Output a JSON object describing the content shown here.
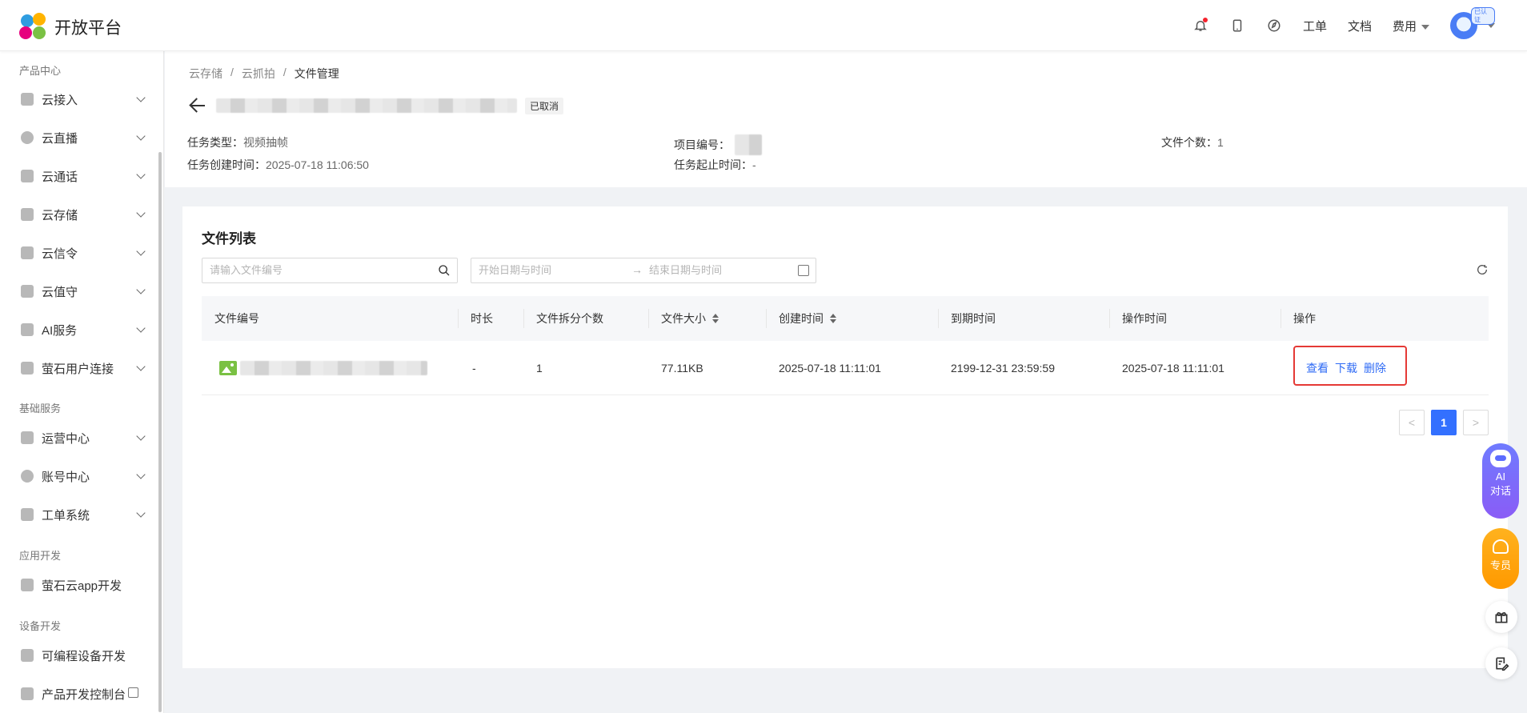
{
  "header": {
    "brand": "开放平台",
    "nav": [
      "工单",
      "文档"
    ],
    "fee_label": "费用",
    "avatar_badge": "已认证"
  },
  "sidebar": {
    "sections": [
      {
        "title": "产品中心",
        "items": [
          "云接入",
          "云直播",
          "云通话",
          "云存储",
          "云信令",
          "云值守",
          "AI服务",
          "萤石用户连接"
        ]
      },
      {
        "title": "基础服务",
        "items": [
          "运营中心",
          "账号中心",
          "工单系统"
        ]
      },
      {
        "title": "应用开发",
        "items": [
          "萤石云app开发"
        ]
      },
      {
        "title": "设备开发",
        "items": [
          "可编程设备开发",
          "产品开发控制台"
        ]
      }
    ]
  },
  "breadcrumb": [
    "云存储",
    "云抓拍",
    "文件管理"
  ],
  "breadcrumb_sep": "/",
  "task": {
    "status": "已取消",
    "type_label": "任务类型：",
    "type_value": "视频抽帧",
    "created_label": "任务创建时间：",
    "created_value": "2025-07-18 11:06:50",
    "project_label": "项目编号：",
    "period_label": "任务起止时间：",
    "period_value": "-",
    "count_label": "文件个数：",
    "count_value": "1"
  },
  "file_list": {
    "title": "文件列表",
    "search_placeholder": "请输入文件编号",
    "start_placeholder": "开始日期与时间",
    "range_arrow": "→",
    "end_placeholder": "结束日期与时间",
    "columns": [
      "文件编号",
      "时长",
      "文件拆分个数",
      "文件大小",
      "创建时间",
      "到期时间",
      "操作时间",
      "操作"
    ],
    "rows": [
      {
        "duration": "-",
        "splits": "1",
        "size": "77.11KB",
        "created": "2025-07-18 11:11:01",
        "expires": "2199-12-31 23:59:59",
        "operated": "2025-07-18 11:11:01",
        "actions": [
          "查看",
          "下载",
          "删除"
        ]
      }
    ],
    "pagination": {
      "prev": "<",
      "current": "1",
      "next": ">"
    }
  },
  "floating": {
    "ai_line1": "AI",
    "ai_line2": "对话",
    "expert": "专员"
  }
}
